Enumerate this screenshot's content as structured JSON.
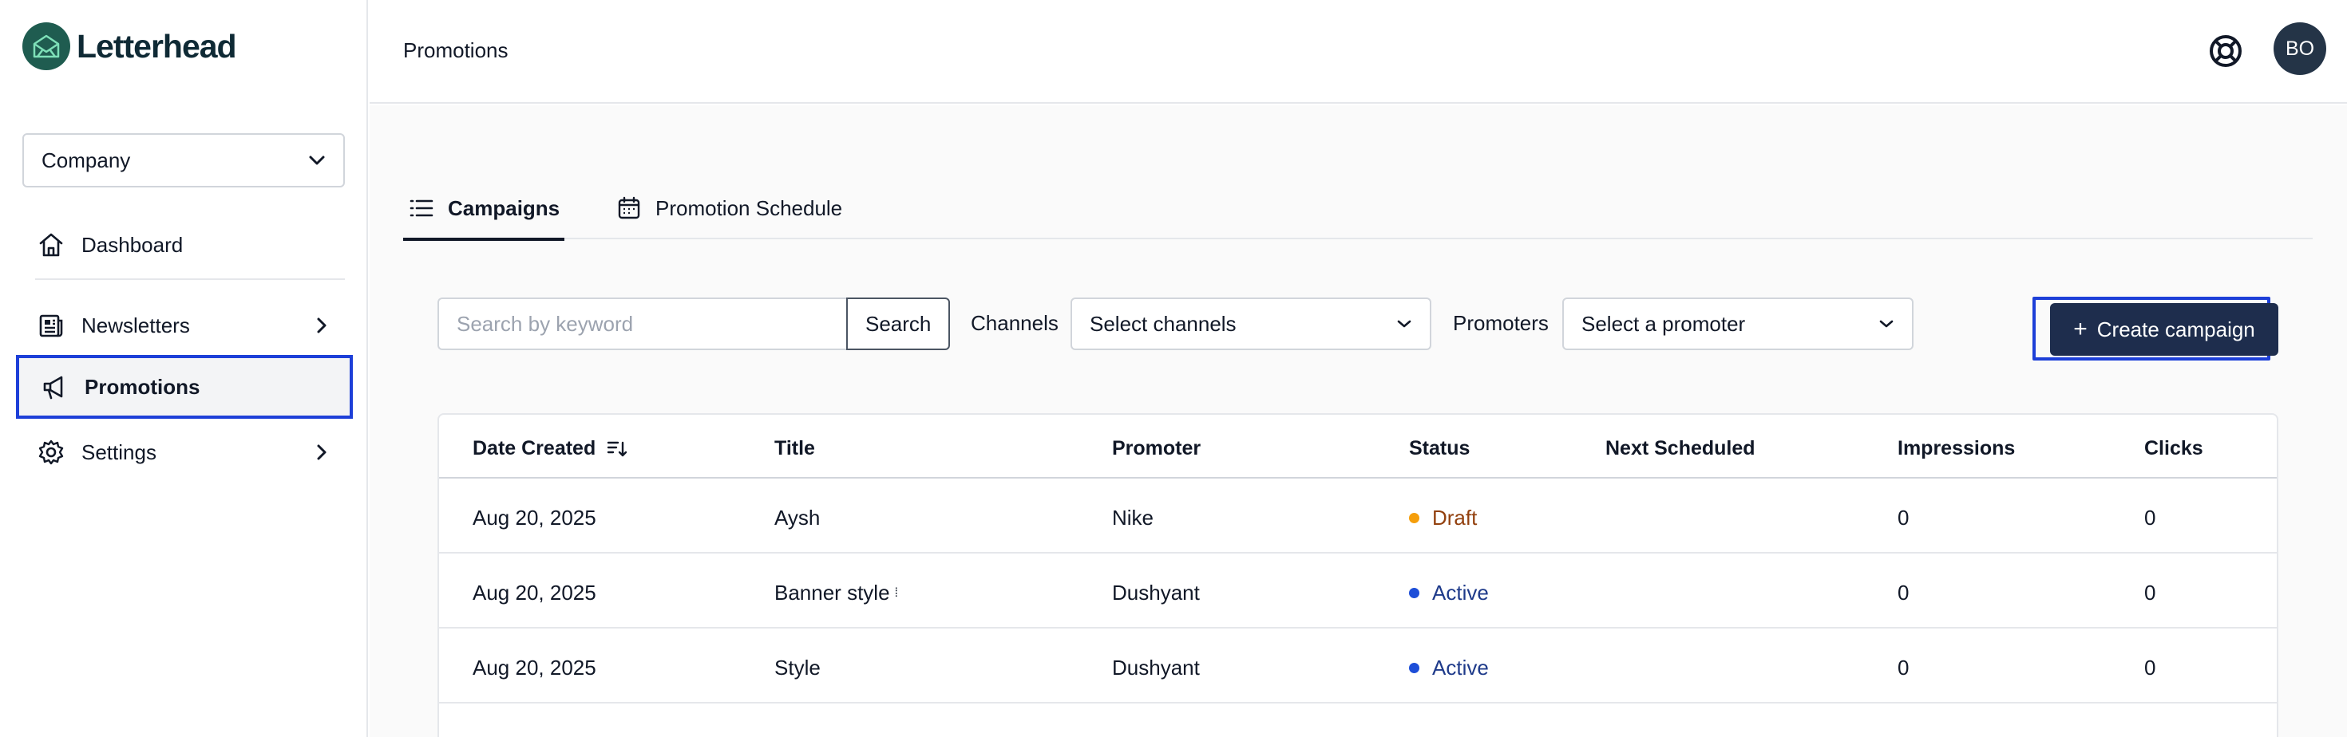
{
  "brand": {
    "name": "Letterhead",
    "accent": "#1f5c50",
    "highlight": "#1d3fd8"
  },
  "sidebar": {
    "company_select": "Company",
    "items": [
      {
        "label": "Dashboard",
        "icon": "home-icon"
      },
      {
        "label": "Newsletters",
        "icon": "newspaper-icon"
      },
      {
        "label": "Promotions",
        "icon": "megaphone-icon",
        "active": true
      },
      {
        "label": "Settings",
        "icon": "gear-icon"
      }
    ]
  },
  "header": {
    "title": "Promotions",
    "avatar_initials": "BO",
    "help_icon": "lifebuoy-icon"
  },
  "tabs": [
    {
      "label": "Campaigns",
      "icon": "list-icon",
      "active": true
    },
    {
      "label": "Promotion Schedule",
      "icon": "calendar-icon"
    }
  ],
  "filters": {
    "search_placeholder": "Search by keyword",
    "search_button": "Search",
    "channels_label": "Channels",
    "channels_value": "Select channels",
    "promoters_label": "Promoters",
    "promoters_value": "Select a promoter"
  },
  "create_button": "Create campaign",
  "table": {
    "columns": [
      "Date Created",
      "Title",
      "Promoter",
      "Status",
      "Next Scheduled",
      "Impressions",
      "Clicks"
    ],
    "rows": [
      {
        "date": "Aug 20, 2025",
        "title": "Aysh",
        "promoter": "Nike",
        "status": "Draft",
        "status_color": "#f59e0b",
        "next": "",
        "impressions": "0",
        "clicks": "0"
      },
      {
        "date": "Aug 20, 2025",
        "title": "Banner style",
        "promoter": "Dushyant",
        "status": "Active",
        "status_color": "#1d4ed8",
        "next": "",
        "impressions": "0",
        "clicks": "0"
      },
      {
        "date": "Aug 20, 2025",
        "title": "Style",
        "promoter": "Dushyant",
        "status": "Active",
        "status_color": "#1d4ed8",
        "next": "",
        "impressions": "0",
        "clicks": "0"
      }
    ]
  }
}
